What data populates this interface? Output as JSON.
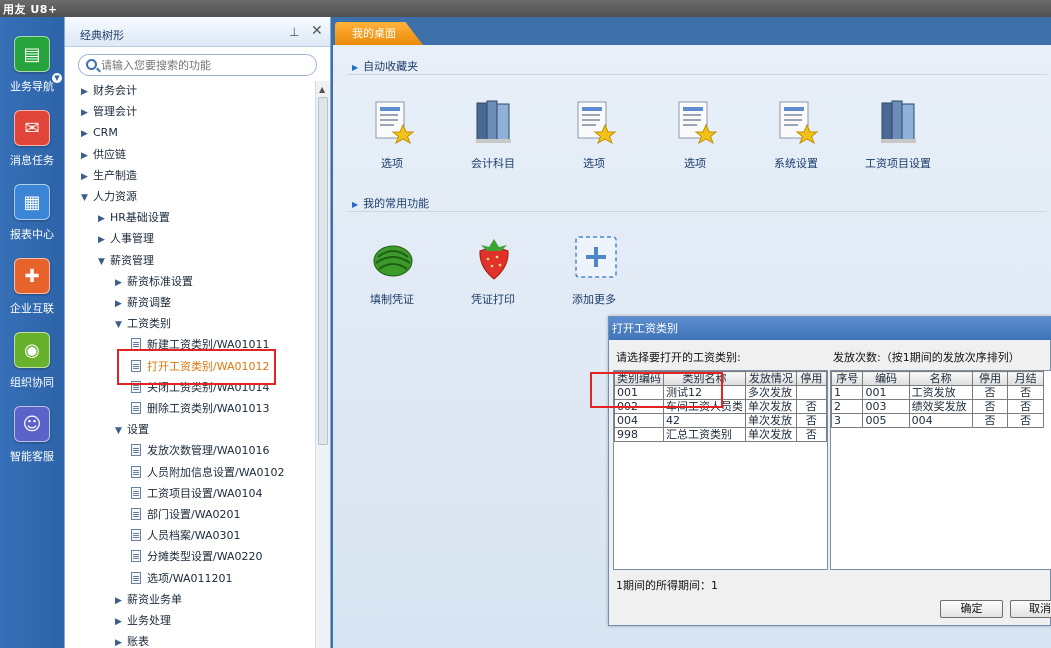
{
  "app": {
    "logo": "用友 U8+"
  },
  "leftnav": [
    {
      "label": "业务导航",
      "icon": "business-nav-icon",
      "color": "#27a33b"
    },
    {
      "label": "消息任务",
      "icon": "message-task-icon",
      "color": "#e2463a"
    },
    {
      "label": "报表中心",
      "icon": "report-center-icon",
      "color": "#3b84d6"
    },
    {
      "label": "企业互联",
      "icon": "enterprise-connect-icon",
      "color": "#e8622b"
    },
    {
      "label": "组织协同",
      "icon": "org-collab-icon",
      "color": "#68b12c"
    },
    {
      "label": "智能客服",
      "icon": "smart-service-icon",
      "color": "#5b62c8"
    }
  ],
  "tree": {
    "title": "经典树形",
    "search_placeholder": "请输入您要搜索的功能",
    "nodes": [
      {
        "label": "财务会计",
        "arrow": "▶"
      },
      {
        "label": "管理会计",
        "arrow": "▶"
      },
      {
        "label": "CRM",
        "arrow": "▶"
      },
      {
        "label": "供应链",
        "arrow": "▶"
      },
      {
        "label": "生产制造",
        "arrow": "▶"
      },
      {
        "label": "人力资源",
        "arrow": "▼"
      },
      {
        "label": "HR基础设置",
        "arrow": "▶"
      },
      {
        "label": "人事管理",
        "arrow": "▶"
      },
      {
        "label": "薪资管理",
        "arrow": "▼"
      },
      {
        "label": "薪资标准设置",
        "arrow": "▶"
      },
      {
        "label": "薪资调整",
        "arrow": "▶"
      },
      {
        "label": "工资类别",
        "arrow": "▼"
      },
      {
        "label": "新建工资类别/WA01011",
        "arrow": ""
      },
      {
        "label": "打开工资类别/WA01012",
        "arrow": ""
      },
      {
        "label": "关闭工资类别/WA01014",
        "arrow": ""
      },
      {
        "label": "删除工资类别/WA01013",
        "arrow": ""
      },
      {
        "label": "设置",
        "arrow": "▼"
      },
      {
        "label": "发放次数管理/WA01016",
        "arrow": ""
      },
      {
        "label": "人员附加信息设置/WA0102",
        "arrow": ""
      },
      {
        "label": "工资项目设置/WA0104",
        "arrow": ""
      },
      {
        "label": "部门设置/WA0201",
        "arrow": ""
      },
      {
        "label": "人员档案/WA0301",
        "arrow": ""
      },
      {
        "label": "分摊类型设置/WA0220",
        "arrow": ""
      },
      {
        "label": "选项/WA011201",
        "arrow": ""
      },
      {
        "label": "薪资业务单",
        "arrow": "▶"
      },
      {
        "label": "业务处理",
        "arrow": "▶"
      },
      {
        "label": "账表",
        "arrow": "▶"
      }
    ]
  },
  "main": {
    "tab_label": "我的桌面",
    "favorites_title": "自动收藏夹",
    "favorites": [
      {
        "label": "选项",
        "icon": "doc-star-icon"
      },
      {
        "label": "会计科目",
        "icon": "books-icon"
      },
      {
        "label": "选项",
        "icon": "doc-star-icon"
      },
      {
        "label": "选项",
        "icon": "doc-star-icon"
      },
      {
        "label": "系统设置",
        "icon": "doc-star-icon"
      },
      {
        "label": "工资项目设置",
        "icon": "books-icon"
      }
    ],
    "common_title": "我的常用功能",
    "common": [
      {
        "label": "填制凭证",
        "icon": "watermelon-icon"
      },
      {
        "label": "凭证打印",
        "icon": "strawberry-icon"
      },
      {
        "label": "添加更多",
        "icon": "add-more-icon"
      }
    ]
  },
  "dialog": {
    "title": "打开工资类别",
    "left_prompt": "请选择要打开的工资类别:",
    "right_prompt": "发放次数:（按1期间的发放次序排列）",
    "left_headers": [
      "类别编码",
      "类别名称",
      "发放情况",
      "停用"
    ],
    "left_rows": [
      [
        "001",
        "测试12",
        "多次发放",
        ""
      ],
      [
        "002",
        "车间工资人员类",
        "单次发放",
        "否"
      ],
      [
        "004",
        "42",
        "单次发放",
        "否"
      ],
      [
        "998",
        "汇总工资类别",
        "单次发放",
        "否"
      ]
    ],
    "right_headers": [
      "序号",
      "编码",
      "名称",
      "停用",
      "月结"
    ],
    "right_rows": [
      [
        "1",
        "001",
        "工资发放",
        "否",
        "否"
      ],
      [
        "2",
        "003",
        "绩效奖发放",
        "否",
        "否"
      ],
      [
        "3",
        "005",
        "004",
        "否",
        "否"
      ]
    ],
    "periods_text": "1期间的所得期间：1",
    "ok_label": "确定",
    "cancel_label": "取消"
  }
}
